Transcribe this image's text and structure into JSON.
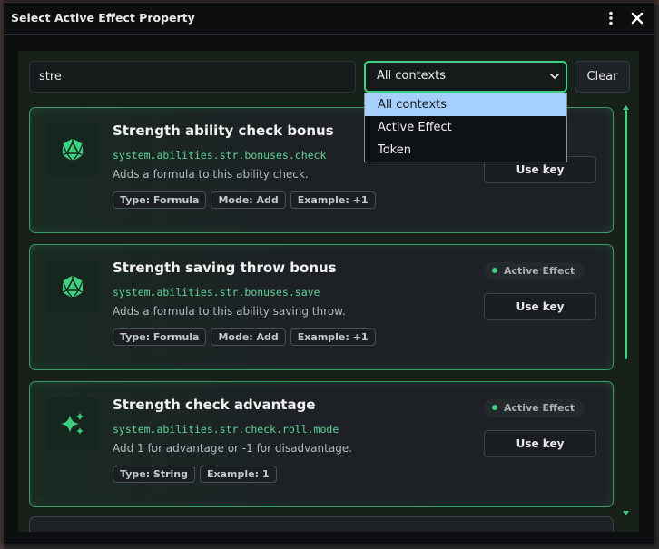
{
  "window": {
    "title": "Select Active Effect Property"
  },
  "search": {
    "value": "stre"
  },
  "context_select": {
    "selected": "All contexts",
    "options": [
      "All contexts",
      "Active Effect",
      "Token"
    ]
  },
  "clear_label": "Clear",
  "cards": [
    {
      "title": "Strength ability check bonus",
      "key": "system.abilities.str.bonuses.check",
      "description": "Adds a formula to this ability check.",
      "tags": [
        "Type: Formula",
        "Mode: Add",
        "Example: +1"
      ],
      "status": "",
      "use_key_label": "Use key",
      "icon": "d20-icon"
    },
    {
      "title": "Strength saving throw bonus",
      "key": "system.abilities.str.bonuses.save",
      "description": "Adds a formula to this ability saving throw.",
      "tags": [
        "Type: Formula",
        "Mode: Add",
        "Example: +1"
      ],
      "status": "Active Effect",
      "use_key_label": "Use key",
      "icon": "d20-icon"
    },
    {
      "title": "Strength check advantage",
      "key": "system.abilities.str.check.roll.mode",
      "description": "Add 1 for advantage or -1 for disadvantage.",
      "tags": [
        "Type: String",
        "Example: 1"
      ],
      "status": "Active Effect",
      "use_key_label": "Use key",
      "icon": "sparkles-icon"
    }
  ],
  "colors": {
    "accent": "#41d085",
    "key_text": "#5ed598",
    "dropdown_highlight": "#a5cfff"
  }
}
